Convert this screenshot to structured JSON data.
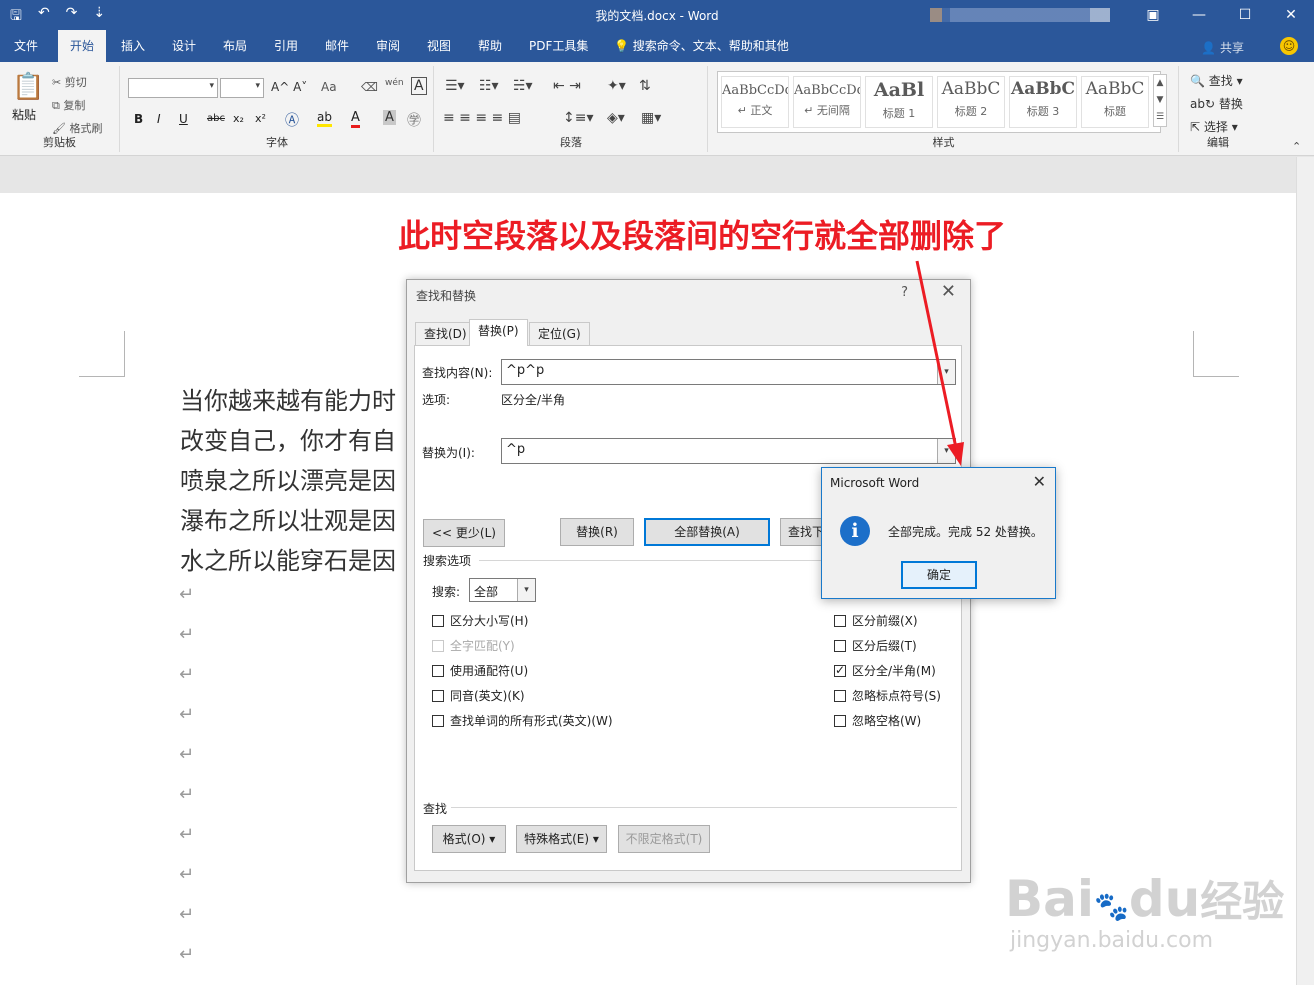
{
  "window": {
    "title": "我的文档.docx  -  Word",
    "qat_icons": [
      "save-icon",
      "undo-icon",
      "redo-icon",
      "customize-qat-icon"
    ],
    "controls": [
      "restore-ribbon-icon",
      "minimize-icon",
      "maximize-icon",
      "close-icon"
    ]
  },
  "tabs": [
    {
      "label": "文件"
    },
    {
      "label": "开始",
      "active": true
    },
    {
      "label": "插入"
    },
    {
      "label": "设计"
    },
    {
      "label": "布局"
    },
    {
      "label": "引用"
    },
    {
      "label": "邮件"
    },
    {
      "label": "审阅"
    },
    {
      "label": "视图"
    },
    {
      "label": "帮助"
    },
    {
      "label": "PDF工具集"
    }
  ],
  "tell_me": "搜索命令、文本、帮助和其他",
  "share": "共享",
  "ribbon": {
    "clipboard": {
      "label": "剪贴板",
      "paste": "粘贴",
      "cut": "剪切",
      "copy": "复制",
      "format_painter": "格式刷"
    },
    "font": {
      "label": "字体",
      "font_name": "",
      "font_size": "",
      "bold": "B",
      "italic": "I",
      "underline": "U",
      "strike": "abc",
      "subscript": "x₂",
      "superscript": "x²",
      "aa": "Aa",
      "wen": "wén",
      "A": "A"
    },
    "paragraph": {
      "label": "段落"
    },
    "styles": {
      "label": "样式",
      "items": [
        {
          "sample": "AaBbCcDd",
          "name": "↵ 正文"
        },
        {
          "sample": "AaBbCcDd",
          "name": "↵ 无间隔"
        },
        {
          "sample": "AaBl",
          "name": "标题 1"
        },
        {
          "sample": "AaBbC",
          "name": "标题 2"
        },
        {
          "sample": "AaBbC",
          "name": "标题 3"
        },
        {
          "sample": "AaBbC",
          "name": "标题"
        }
      ]
    },
    "editing": {
      "label": "编辑",
      "find": "查找",
      "replace": "替换",
      "select": "选择"
    }
  },
  "document": {
    "lines": [
      "当你越来越有能力时",
      "改变自己，你才有自",
      "喷泉之所以漂亮是因",
      "瀑布之所以壮观是因",
      "水之所以能穿石是因"
    ],
    "paragraph_mark": "↵",
    "empty_paragraph_count": 10
  },
  "annotation": "此时空段落以及段落间的空行就全部删除了",
  "find_replace": {
    "title": "查找和替换",
    "help": "?",
    "tabs": [
      "查找(D)",
      "替换(P)",
      "定位(G)"
    ],
    "find_label": "查找内容(N):",
    "find_value": "^p^p",
    "options_label": "选项:",
    "options_value": "区分全/半角",
    "replace_label": "替换为(I):",
    "replace_value": "^p",
    "btn_less": "<< 更少(L)",
    "btn_replace": "替换(R)",
    "btn_replace_all": "全部替换(A)",
    "btn_find_next": "查找下一处(F)",
    "search_options": "搜索选项",
    "search_label": "搜索:",
    "search_value": "全部",
    "checkboxes_left": [
      {
        "label": "区分大小写(H)",
        "checked": false,
        "disabled": false
      },
      {
        "label": "全字匹配(Y)",
        "checked": false,
        "disabled": true
      },
      {
        "label": "使用通配符(U)",
        "checked": false,
        "disabled": false
      },
      {
        "label": "同音(英文)(K)",
        "checked": false,
        "disabled": false
      },
      {
        "label": "查找单词的所有形式(英文)(W)",
        "checked": false,
        "disabled": false
      }
    ],
    "checkboxes_right": [
      {
        "label": "区分前缀(X)",
        "checked": false
      },
      {
        "label": "区分后缀(T)",
        "checked": false
      },
      {
        "label": "区分全/半角(M)",
        "checked": true
      },
      {
        "label": "忽略标点符号(S)",
        "checked": false
      },
      {
        "label": "忽略空格(W)",
        "checked": false
      }
    ],
    "find_section": "查找",
    "btn_format": "格式(O) ▾",
    "btn_special": "特殊格式(E) ▾",
    "btn_no_format": "不限定格式(T)"
  },
  "message_box": {
    "title": "Microsoft Word",
    "icon": "info-icon",
    "text": "全部完成。完成 52 处替换。",
    "ok": "确定"
  },
  "watermark": {
    "brand": "Bai",
    "du": "du",
    "jy": "经验",
    "url": "jingyan.baidu.com"
  },
  "colors": {
    "word_blue": "#2b579a",
    "annotation_red": "#ec1c24",
    "focus_blue": "#0078d7"
  }
}
